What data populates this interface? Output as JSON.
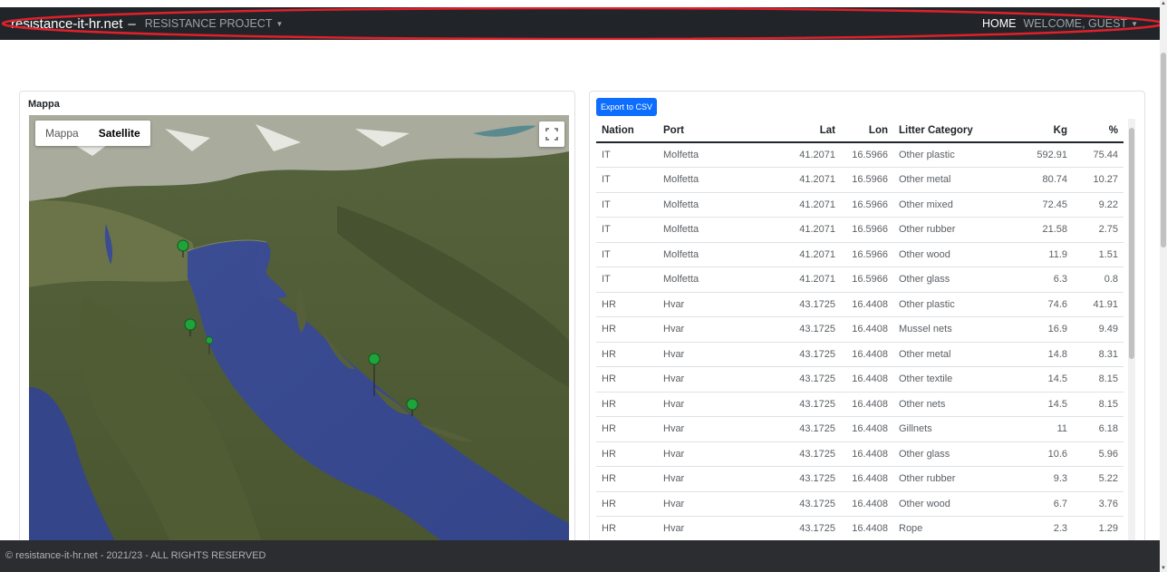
{
  "navbar": {
    "brand": "resistance-it-hr.net",
    "separator": "–",
    "project_menu": "RESISTANCE PROJECT",
    "home": "HOME",
    "welcome_menu": "WELCOME, GUEST"
  },
  "map": {
    "title": "Mappa",
    "map_type_map": "Mappa",
    "map_type_satellite": "Satellite"
  },
  "table": {
    "export_label": "Export to CSV",
    "columns": [
      "Nation",
      "Port",
      "Lat",
      "Lon",
      "Litter Category",
      "Kg",
      "%"
    ],
    "rows": [
      [
        "IT",
        "Molfetta",
        "41.2071",
        "16.5966",
        "Other plastic",
        "592.91",
        "75.44"
      ],
      [
        "IT",
        "Molfetta",
        "41.2071",
        "16.5966",
        "Other metal",
        "80.74",
        "10.27"
      ],
      [
        "IT",
        "Molfetta",
        "41.2071",
        "16.5966",
        "Other mixed",
        "72.45",
        "9.22"
      ],
      [
        "IT",
        "Molfetta",
        "41.2071",
        "16.5966",
        "Other rubber",
        "21.58",
        "2.75"
      ],
      [
        "IT",
        "Molfetta",
        "41.2071",
        "16.5966",
        "Other wood",
        "11.9",
        "1.51"
      ],
      [
        "IT",
        "Molfetta",
        "41.2071",
        "16.5966",
        "Other glass",
        "6.3",
        "0.8"
      ],
      [
        "HR",
        "Hvar",
        "43.1725",
        "16.4408",
        "Other plastic",
        "74.6",
        "41.91"
      ],
      [
        "HR",
        "Hvar",
        "43.1725",
        "16.4408",
        "Mussel nets",
        "16.9",
        "9.49"
      ],
      [
        "HR",
        "Hvar",
        "43.1725",
        "16.4408",
        "Other metal",
        "14.8",
        "8.31"
      ],
      [
        "HR",
        "Hvar",
        "43.1725",
        "16.4408",
        "Other textile",
        "14.5",
        "8.15"
      ],
      [
        "HR",
        "Hvar",
        "43.1725",
        "16.4408",
        "Other nets",
        "14.5",
        "8.15"
      ],
      [
        "HR",
        "Hvar",
        "43.1725",
        "16.4408",
        "Gillnets",
        "11",
        "6.18"
      ],
      [
        "HR",
        "Hvar",
        "43.1725",
        "16.4408",
        "Other glass",
        "10.6",
        "5.96"
      ],
      [
        "HR",
        "Hvar",
        "43.1725",
        "16.4408",
        "Other rubber",
        "9.3",
        "5.22"
      ],
      [
        "HR",
        "Hvar",
        "43.1725",
        "16.4408",
        "Other wood",
        "6.7",
        "3.76"
      ],
      [
        "HR",
        "Hvar",
        "43.1725",
        "16.4408",
        "Rope",
        "2.3",
        "1.29"
      ]
    ]
  },
  "footer": {
    "text": "© resistance-it-hr.net - 2021/23 - ALL RIGHTS RESERVED"
  },
  "colors": {
    "navbar_bg": "#212529",
    "footer_bg": "#2b2d30",
    "export_button": "#0d6efd",
    "marker_green": "#1fa33a",
    "sea": "#3e4f96",
    "land": "#4a5a32",
    "highlight_ring": "#e0202a"
  },
  "icons": [
    "caret-down-icon",
    "fullscreen-icon",
    "map-marker-icon"
  ]
}
